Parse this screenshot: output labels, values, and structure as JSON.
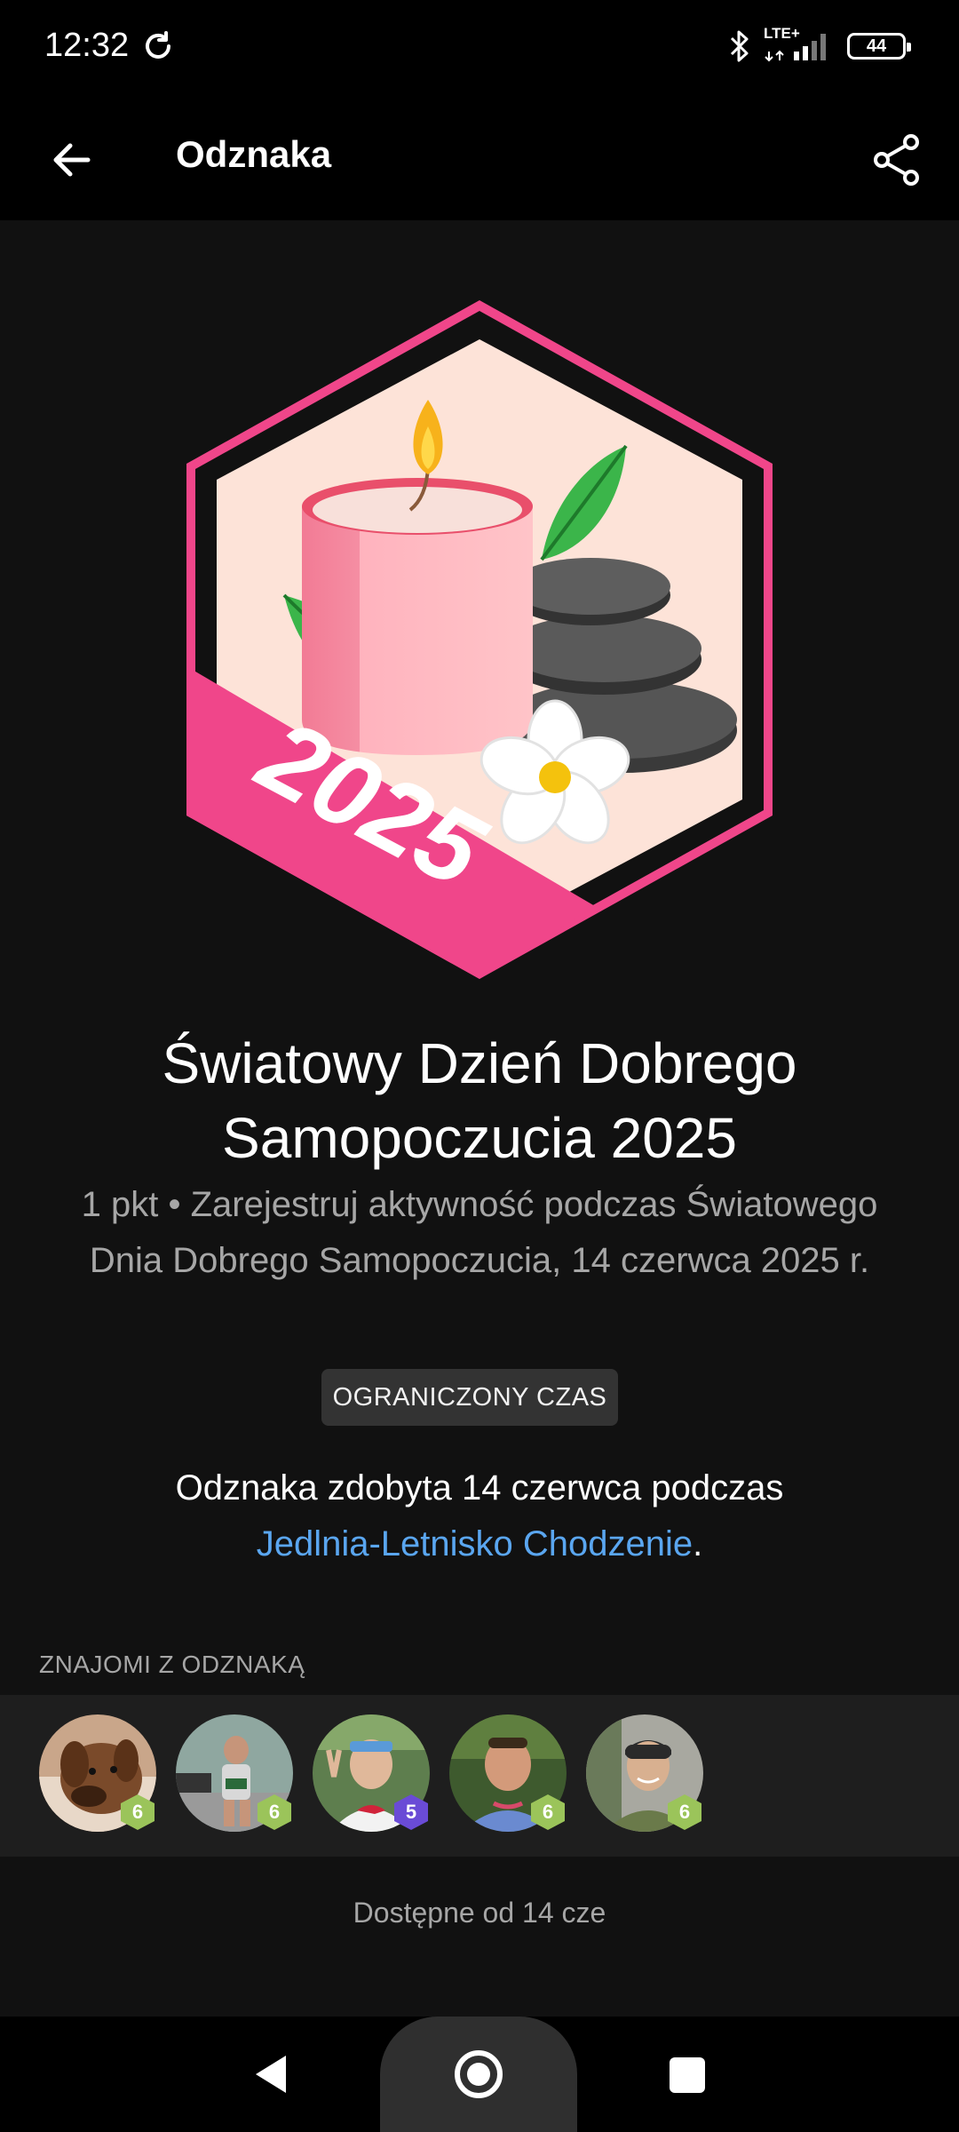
{
  "status_bar": {
    "time": "12:32",
    "network": "LTE+",
    "battery": "44"
  },
  "app_bar": {
    "title": "Odznaka"
  },
  "badge": {
    "year": "2025",
    "title": "Światowy Dzień Dobrego Samopoczucia 2025",
    "description": "1 pkt • Zarejestruj aktywność podczas Światowego Dnia Dobrego Samopoczucia, 14 czerwca 2025 r.",
    "limited_chip": "OGRANICZONY CZAS",
    "earned_prefix": "Odznaka zdobyta 14 czerwca podczas",
    "earned_activity": "Jedlnia-Letnisko Chodzenie",
    "earned_suffix": ".",
    "colors": {
      "frame": "#f0468a",
      "background": "#fde3d8"
    }
  },
  "friends": {
    "label": "ZNAJOMI Z ODZNAKĄ",
    "items": [
      {
        "level": "6",
        "level_color": "#9bc45a"
      },
      {
        "level": "6",
        "level_color": "#9bc45a"
      },
      {
        "level": "5",
        "level_color": "#6a4bd6"
      },
      {
        "level": "6",
        "level_color": "#9bc45a"
      },
      {
        "level": "6",
        "level_color": "#9bc45a"
      }
    ]
  },
  "available": "Dostępne od 14 cze"
}
